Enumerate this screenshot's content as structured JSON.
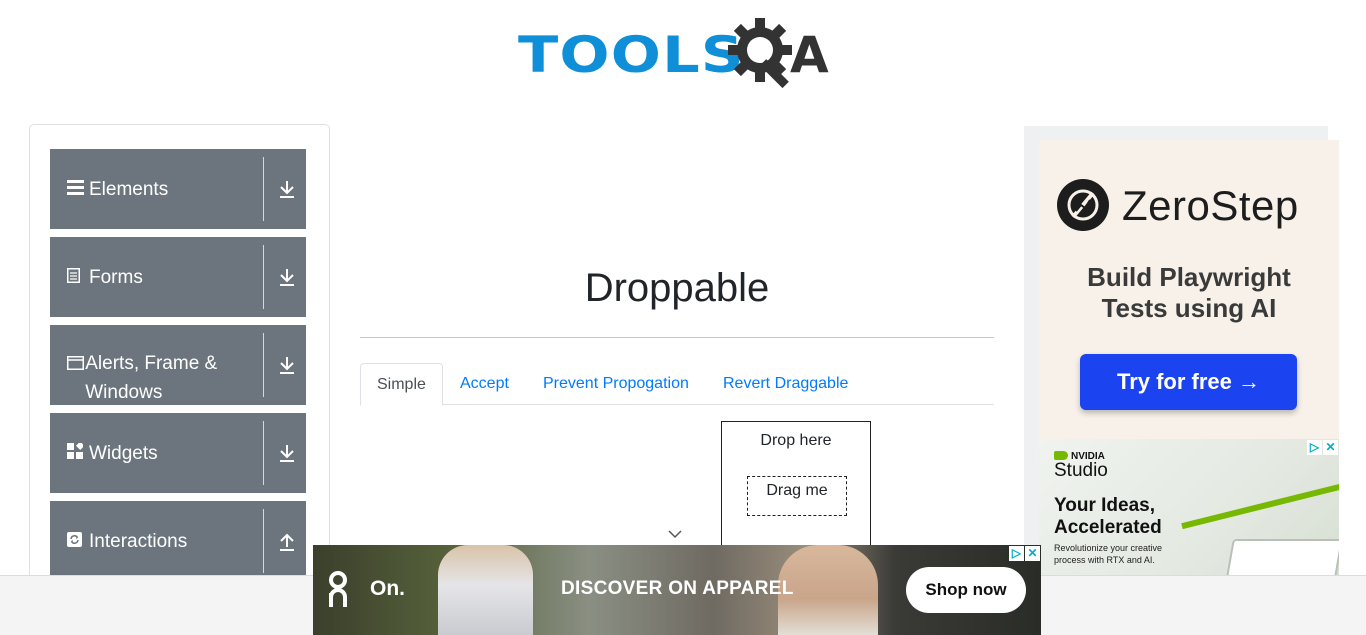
{
  "header": {
    "logo_text": "TOOLS",
    "logo_suffix": "A",
    "logo_icon": "gear-magnifier-icon"
  },
  "sidebar": {
    "groups": [
      {
        "label": "Elements",
        "icon": "hamburger-icon",
        "arrow": "download-arrow-icon"
      },
      {
        "label": "Forms",
        "icon": "document-icon",
        "arrow": "download-arrow-icon"
      },
      {
        "label": "Alerts, Frame & Windows",
        "icon": "window-icon",
        "arrow": "download-arrow-icon"
      },
      {
        "label": "Widgets",
        "icon": "widgets-icon",
        "arrow": "download-arrow-icon"
      },
      {
        "label": "Interactions",
        "icon": "refresh-icon",
        "arrow": "upload-arrow-icon"
      }
    ]
  },
  "main": {
    "title": "Droppable",
    "tabs": [
      {
        "label": "Simple",
        "active": true
      },
      {
        "label": "Accept",
        "active": false
      },
      {
        "label": "Prevent Propogation",
        "active": false
      },
      {
        "label": "Revert Draggable",
        "active": false
      }
    ],
    "drop_label": "Drop here",
    "drag_label": "Drag me"
  },
  "ads": {
    "zerostep": {
      "name": "ZeroStep",
      "tagline_1": "Build Playwright",
      "tagline_2": "Tests using AI",
      "cta": "Try for free →",
      "cta_color": "#1b43f0"
    },
    "nvidia": {
      "brand": "NVIDIA",
      "product": "Studio",
      "headline_1": "Your Ideas,",
      "headline_2": "Accelerated",
      "sub_1": "Revolutionize your creative",
      "sub_2": "process with RTX and AI."
    },
    "apparel": {
      "brand": "On.",
      "headline": "DISCOVER ON APPAREL",
      "cta": "Shop now"
    }
  },
  "colors": {
    "accent": "#0e8fd8",
    "sidebar_header": "#6c757d",
    "link": "#007bff"
  }
}
